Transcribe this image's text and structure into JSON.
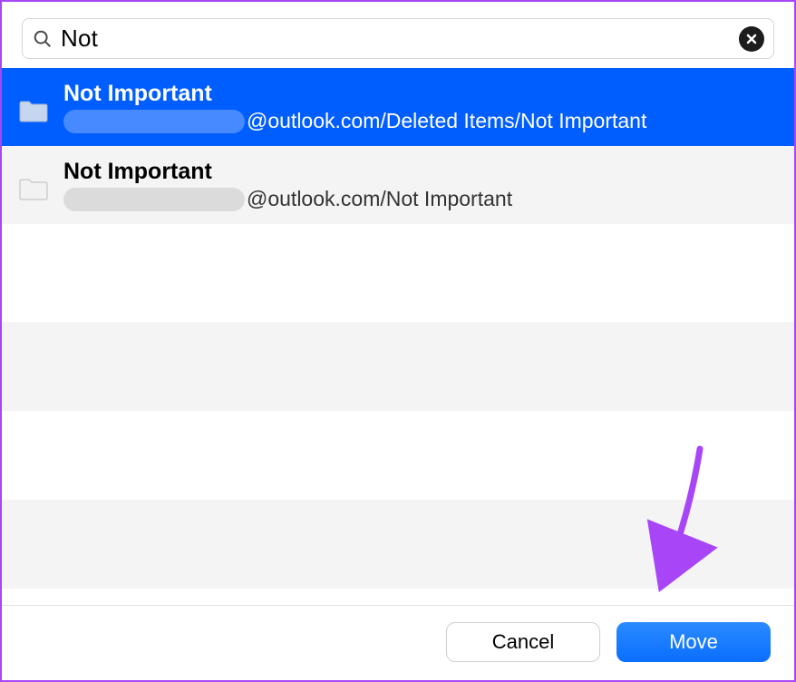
{
  "search": {
    "value": "Not ",
    "placeholder": ""
  },
  "results": [
    {
      "title": "Not Important",
      "path_suffix": "@outlook.com/Deleted Items/Not Important",
      "selected": true
    },
    {
      "title": "Not Important",
      "path_suffix": "@outlook.com/Not Important",
      "selected": false
    }
  ],
  "footer": {
    "cancel_label": "Cancel",
    "move_label": "Move"
  }
}
